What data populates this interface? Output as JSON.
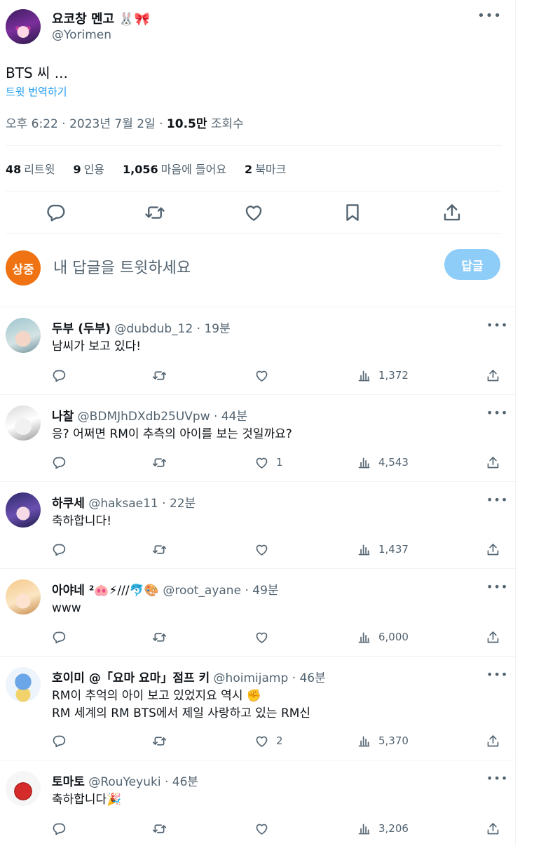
{
  "tweet": {
    "author_name": "요코창 멘고",
    "author_emoji": "🐰🎀",
    "author_handle": "@Yorimen",
    "text": "BTS 씨 ...",
    "translate_label": "트윗 번역하기",
    "time": "오후 6:22 · 2023년 7월 2일 · ",
    "views_value": "10.5만",
    "views_label": " 조회수",
    "more_icon": "more-icon"
  },
  "stats": {
    "retweets_value": "48",
    "retweets_label": "리트윗",
    "quotes_value": "9",
    "quotes_label": "인용",
    "likes_value": "1,056",
    "likes_label": "마음에 들어요",
    "bookmarks_value": "2",
    "bookmarks_label": "북마크"
  },
  "compose": {
    "avatar_text": "상중",
    "placeholder": "내 답글을 트윗하세요",
    "button_label": "답글"
  },
  "replies": [
    {
      "name": "두부 (두부)",
      "meta": " @dubdub_12 · 19분",
      "lines": [
        "남씨가 보고 있다!"
      ],
      "likes": "",
      "views": "1,372"
    },
    {
      "name": "나찰",
      "meta": " @BDMJhDXdb25UVpw · 44분",
      "lines": [
        "응? 어쩌면 RM이 추측의 아이를 보는 것일까요?"
      ],
      "likes": "1",
      "views": "4,543"
    },
    {
      "name": "하쿠세",
      "meta": " @haksae11 · 22분",
      "lines": [
        "축하합니다!"
      ],
      "likes": "",
      "views": "1,437"
    },
    {
      "name": "아야네 ²",
      "name_emoji": " 🐽⚡///🐬🎨",
      "meta": " @root_ayane · 49분",
      "lines": [
        "www"
      ],
      "likes": "",
      "views": "6,000"
    },
    {
      "name": "호이미 @「요마 요마」점프 키",
      "meta": " @hoimijamp · 46분",
      "lines": [
        "RM이 추억의 아이 보고 있었지요 역시 ✊",
        "RM 세계의 RM BTS에서 제일 사랑하고 있는 RM신"
      ],
      "likes": "2",
      "views": "5,370"
    },
    {
      "name": "토마토",
      "meta": " @RouYeyuki · 46분",
      "lines": [
        "축하합니다🎉"
      ],
      "likes": "",
      "views": "3,206"
    }
  ],
  "colors": {
    "accent": "#1d9bf0",
    "reply_button": "#8ecdf8",
    "compose_avatar": "#f07313",
    "muted": "#536471"
  }
}
